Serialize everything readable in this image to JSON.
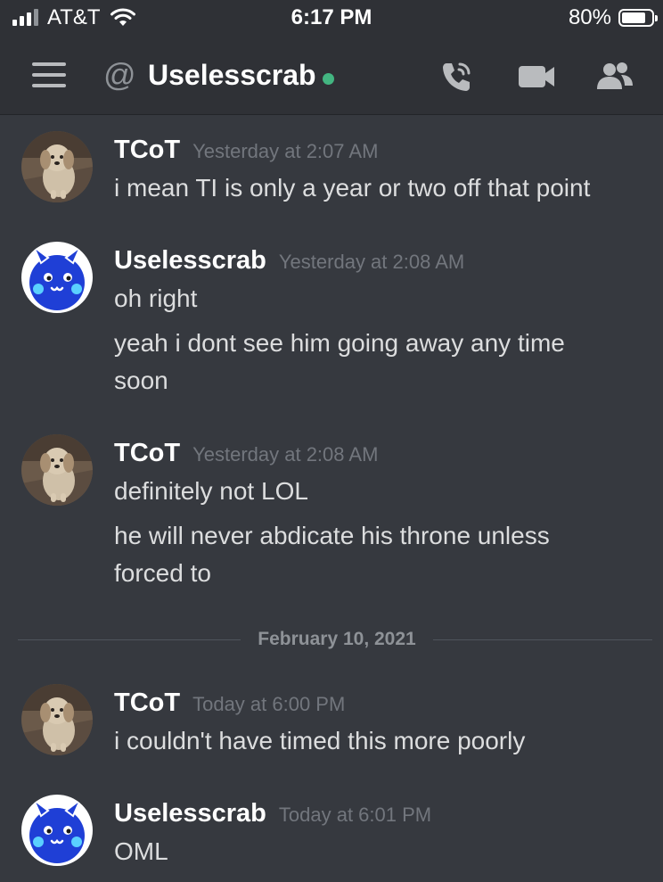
{
  "status_bar": {
    "carrier": "AT&T",
    "time": "6:17 PM",
    "battery": "80%",
    "battery_level": 0.8,
    "signal_icon": "signal-bars-icon",
    "wifi_icon": "wifi-icon"
  },
  "header": {
    "menu_icon": "hamburger-menu-icon",
    "channel_prefix": "@",
    "channel_name": "Uselesscrab",
    "presence": "online",
    "presence_color": "#43b581",
    "actions": [
      "phone-call-icon",
      "video-camera-icon",
      "members-icon"
    ]
  },
  "messages": [
    {
      "author": "TCoT",
      "timestamp": "Yesterday at 2:07 AM",
      "avatar": "dog-photo-avatar",
      "lines": [
        "i mean TI is only a year or two off that point"
      ]
    },
    {
      "author": "Uselesscrab",
      "timestamp": "Yesterday at 2:08 AM",
      "avatar": "blue-creature-avatar",
      "lines": [
        "oh right",
        "yeah i dont see him going away any time",
        "soon"
      ]
    },
    {
      "author": "TCoT",
      "timestamp": "Yesterday at 2:08 AM",
      "avatar": "dog-photo-avatar",
      "lines": [
        "definitely not LOL",
        "he will never abdicate his throne unless",
        "forced to"
      ]
    },
    {
      "author": "TCoT",
      "timestamp": "Today at 6:00 PM",
      "avatar": "dog-photo-avatar",
      "lines": [
        "i couldn't have timed this more poorly"
      ]
    },
    {
      "author": "Uselesscrab",
      "timestamp": "Today at 6:01 PM",
      "avatar": "blue-creature-avatar",
      "lines": [
        "OML"
      ]
    }
  ],
  "date_divider": "February 10, 2021",
  "colors": {
    "background": "#36393f",
    "header_background": "#2f3136",
    "timestamp": "#72767d",
    "message_text": "#dcddde",
    "avatar_blue": "#1f3fd6"
  }
}
